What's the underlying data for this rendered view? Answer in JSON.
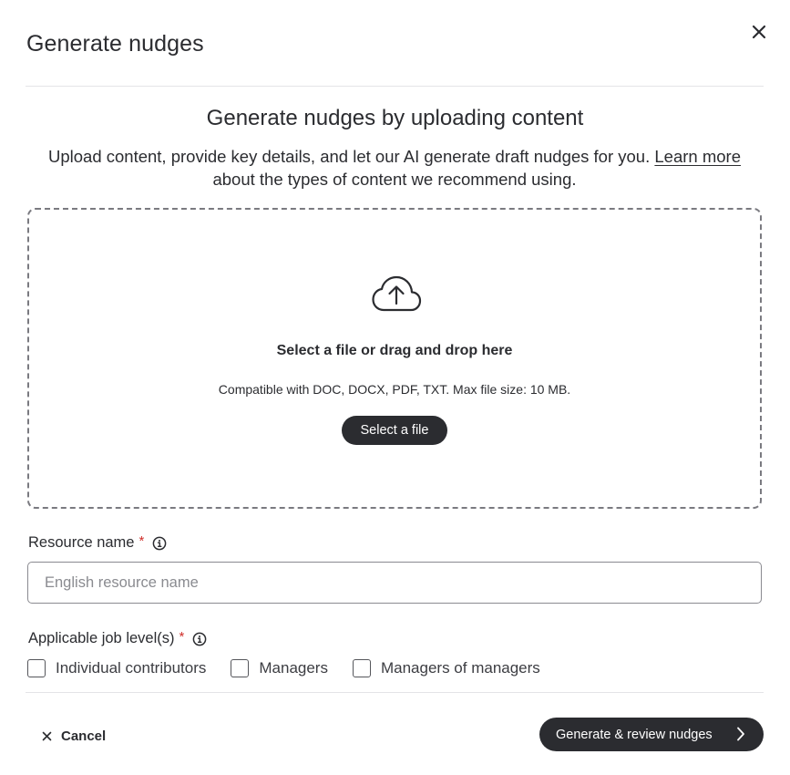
{
  "dialog": {
    "title": "Generate nudges"
  },
  "intro": {
    "heading": "Generate nudges by uploading content",
    "description_before": "Upload content, provide key details, and let our AI generate draft nudges for you. ",
    "learn_more_link": "Learn more",
    "description_after": " about the types of content we recommend using."
  },
  "dropzone": {
    "icon": "cloud-upload-icon",
    "title": "Select a file or drag and drop here",
    "hint": "Compatible with DOC, DOCX, PDF, TXT. Max file size: 10 MB.",
    "button_label": "Select a file"
  },
  "resource_name": {
    "label": "Resource name",
    "required_mark": "*",
    "value": "",
    "placeholder": "English resource name"
  },
  "job_levels": {
    "label": "Applicable job level(s)",
    "required_mark": "*",
    "options": [
      {
        "label": "Individual contributors",
        "checked": false
      },
      {
        "label": "Managers",
        "checked": false
      },
      {
        "label": "Managers of managers",
        "checked": false
      }
    ]
  },
  "footer": {
    "cancel_label": "Cancel",
    "primary_label": "Generate & review nudges"
  },
  "colors": {
    "text": "#2b2c30",
    "primary_button": "#2b2c30",
    "required": "#d0302b",
    "border": "#8a8a90",
    "divider": "#e4e4e7"
  }
}
